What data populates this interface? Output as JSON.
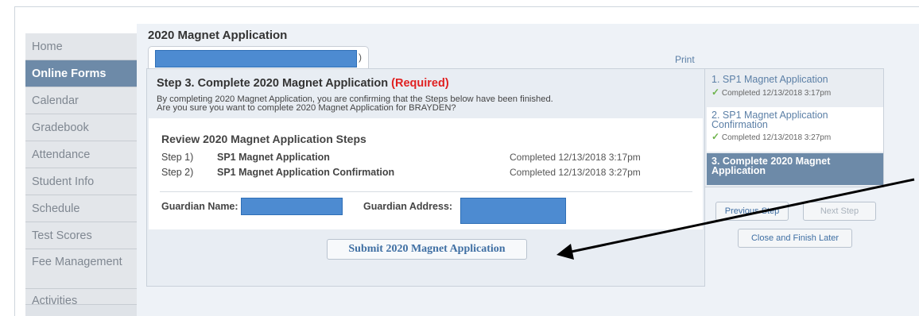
{
  "sidebar": {
    "items": [
      {
        "label": "Home"
      },
      {
        "label": "Online Forms"
      },
      {
        "label": "Calendar"
      },
      {
        "label": "Gradebook"
      },
      {
        "label": "Attendance"
      },
      {
        "label": "Student Info"
      },
      {
        "label": "Schedule"
      },
      {
        "label": "Test Scores"
      },
      {
        "label": "Fee Management"
      },
      {
        "label": "Activities"
      }
    ]
  },
  "main": {
    "title": "2020 Magnet Application",
    "student_tab_suffix": ")",
    "print_label": "Print"
  },
  "form": {
    "step_heading": "Step 3. Complete 2020 Magnet Application",
    "required_label": "(Required)",
    "desc_line1": "By completing 2020 Magnet Application, you are confirming that the Steps below have been finished.",
    "desc_line2": "Are you sure you want to complete 2020 Magnet Application for BRAYDEN?",
    "review_title": "Review 2020 Magnet Application Steps",
    "steps": [
      {
        "num": "Step 1)",
        "name": "SP1 Magnet Application",
        "status": "Completed 12/13/2018 3:17pm"
      },
      {
        "num": "Step 2)",
        "name": "SP1 Magnet Application Confirmation",
        "status": "Completed 12/13/2018 3:27pm"
      }
    ],
    "guardian_name_label": "Guardian Name:",
    "guardian_address_label": "Guardian Address:",
    "submit_label": "Submit 2020 Magnet Application"
  },
  "progress": {
    "steps": [
      {
        "label": "1. SP1 Magnet Application",
        "status": "Completed 12/13/2018 3:17pm"
      },
      {
        "label": "2. SP1 Magnet Application Confirmation",
        "status": "Completed 12/13/2018 3:27pm"
      },
      {
        "label": "3. Complete 2020 Magnet Application"
      }
    ],
    "previous_label": "Previous Step",
    "next_label": "Next Step",
    "close_label": "Close and Finish Later"
  },
  "colors": {
    "accent": "#6d8aa8",
    "link": "#3f6fa3",
    "required": "#e02020",
    "redaction": "#4d8bd1",
    "arrow": "#000000"
  }
}
